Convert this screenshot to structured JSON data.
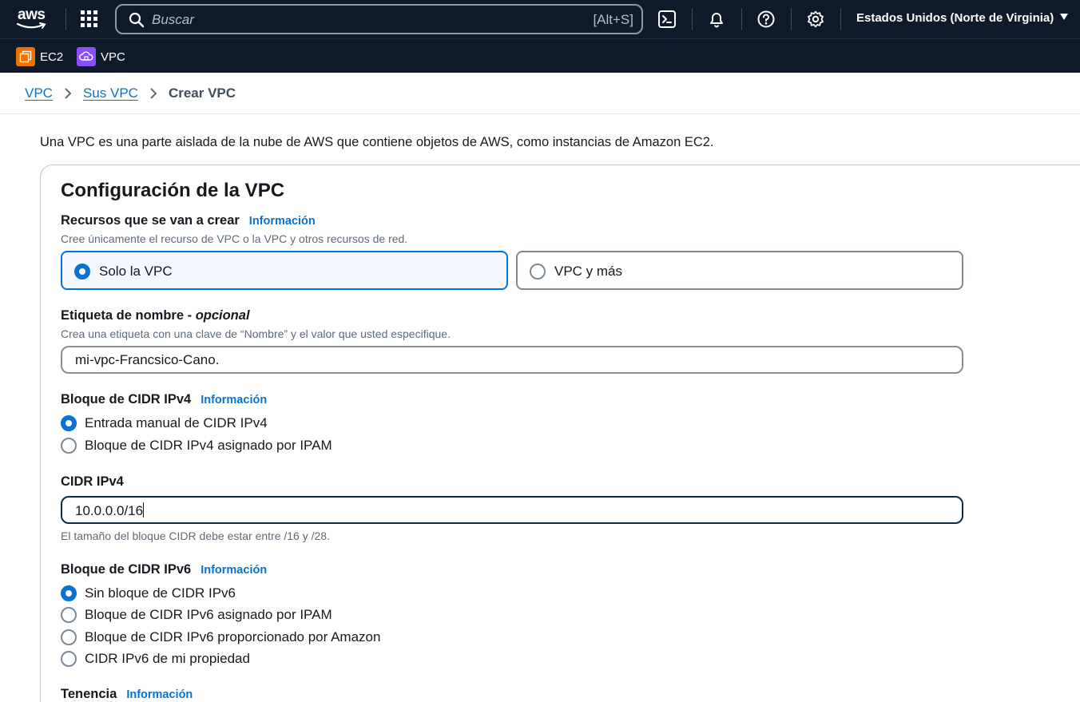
{
  "topnav": {
    "logo_text": "aws",
    "search_placeholder": "Buscar",
    "search_shortcut": "[Alt+S]",
    "icons": [
      "services-grid-icon",
      "cloudshell-icon",
      "bell-icon",
      "help-icon",
      "gear-icon"
    ],
    "region": "Estados Unidos (Norte de Virginia)"
  },
  "favorites": [
    {
      "label": "EC2",
      "color": "#ed7100"
    },
    {
      "label": "VPC",
      "color": "#8c4fff"
    }
  ],
  "breadcrumb": {
    "items": [
      "VPC",
      "Sus VPC"
    ],
    "current": "Crear VPC"
  },
  "intro": "Una VPC es una parte aislada de la nube de AWS que contiene objetos de AWS, como instancias de Amazon EC2.",
  "panel": {
    "title": "Configuración de la VPC",
    "resources": {
      "label": "Recursos que se van a crear",
      "info": "Información",
      "description": "Cree únicamente el recurso de VPC o la VPC y otros recursos de red.",
      "options": [
        "Solo la VPC",
        "VPC y más"
      ],
      "selected": "Solo la VPC"
    },
    "name_tag": {
      "label": "Etiqueta de nombre - ",
      "label_optional": "opcional",
      "description": "Crea una etiqueta con una clave de “Nombre” y el valor que usted especifique.",
      "value": "mi-vpc-Francsico-Cano."
    },
    "ipv4_block": {
      "label": "Bloque de CIDR IPv4",
      "info": "Información",
      "options": [
        "Entrada manual de CIDR IPv4",
        "Bloque de CIDR IPv4 asignado por IPAM"
      ],
      "selected": "Entrada manual de CIDR IPv4"
    },
    "ipv4_cidr": {
      "label": "CIDR IPv4",
      "value": "10.0.0.0/16",
      "hint": "El tamaño del bloque CIDR debe estar entre /16 y /28."
    },
    "ipv6_block": {
      "label": "Bloque de CIDR IPv6",
      "info": "Información",
      "options": [
        "Sin bloque de CIDR IPv6",
        "Bloque de CIDR IPv6 asignado por IPAM",
        "Bloque de CIDR IPv6 proporcionado por Amazon",
        "CIDR IPv6 de mi propiedad"
      ],
      "selected": "Sin bloque de CIDR IPv6"
    },
    "tenancy": {
      "label": "Tenencia",
      "info": "Información"
    }
  },
  "colors": {
    "nav_bg": "#0f1b2a",
    "accent": "#0972d3",
    "selected_tile_bg": "#f2f8fd"
  }
}
